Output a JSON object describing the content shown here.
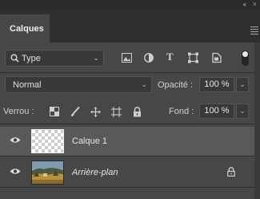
{
  "panel": {
    "collapse_glyph": "‹‹",
    "close_glyph": "×",
    "tab_label": "Calques",
    "menu_icon": "panel-menu-icon"
  },
  "filter": {
    "kind_label": "Type",
    "icons": [
      "image-filter-icon",
      "adjustment-filter-icon",
      "type-filter-icon",
      "shape-filter-icon",
      "smart-object-filter-icon"
    ],
    "type_glyph": "T"
  },
  "blend": {
    "mode": "Normal",
    "opacity_label": "Opacité :",
    "opacity_value": "100 %"
  },
  "lock": {
    "label": "Verrou :",
    "icons": [
      "lock-transparent-pixels-icon",
      "lock-image-pixels-icon",
      "lock-position-icon",
      "lock-artboard-icon",
      "lock-all-icon"
    ],
    "fill_label": "Fond :",
    "fill_value": "100 %"
  },
  "layers": [
    {
      "name": "Calque 1",
      "visible": true,
      "selected": true,
      "italic": false,
      "locked": false
    },
    {
      "name": "Arrière-plan",
      "visible": true,
      "selected": false,
      "italic": true,
      "locked": true
    }
  ],
  "colors": {
    "panel_bg": "#474747",
    "selected_row": "#595959",
    "field_bg": "#393939",
    "text": "#d6d6d6"
  }
}
